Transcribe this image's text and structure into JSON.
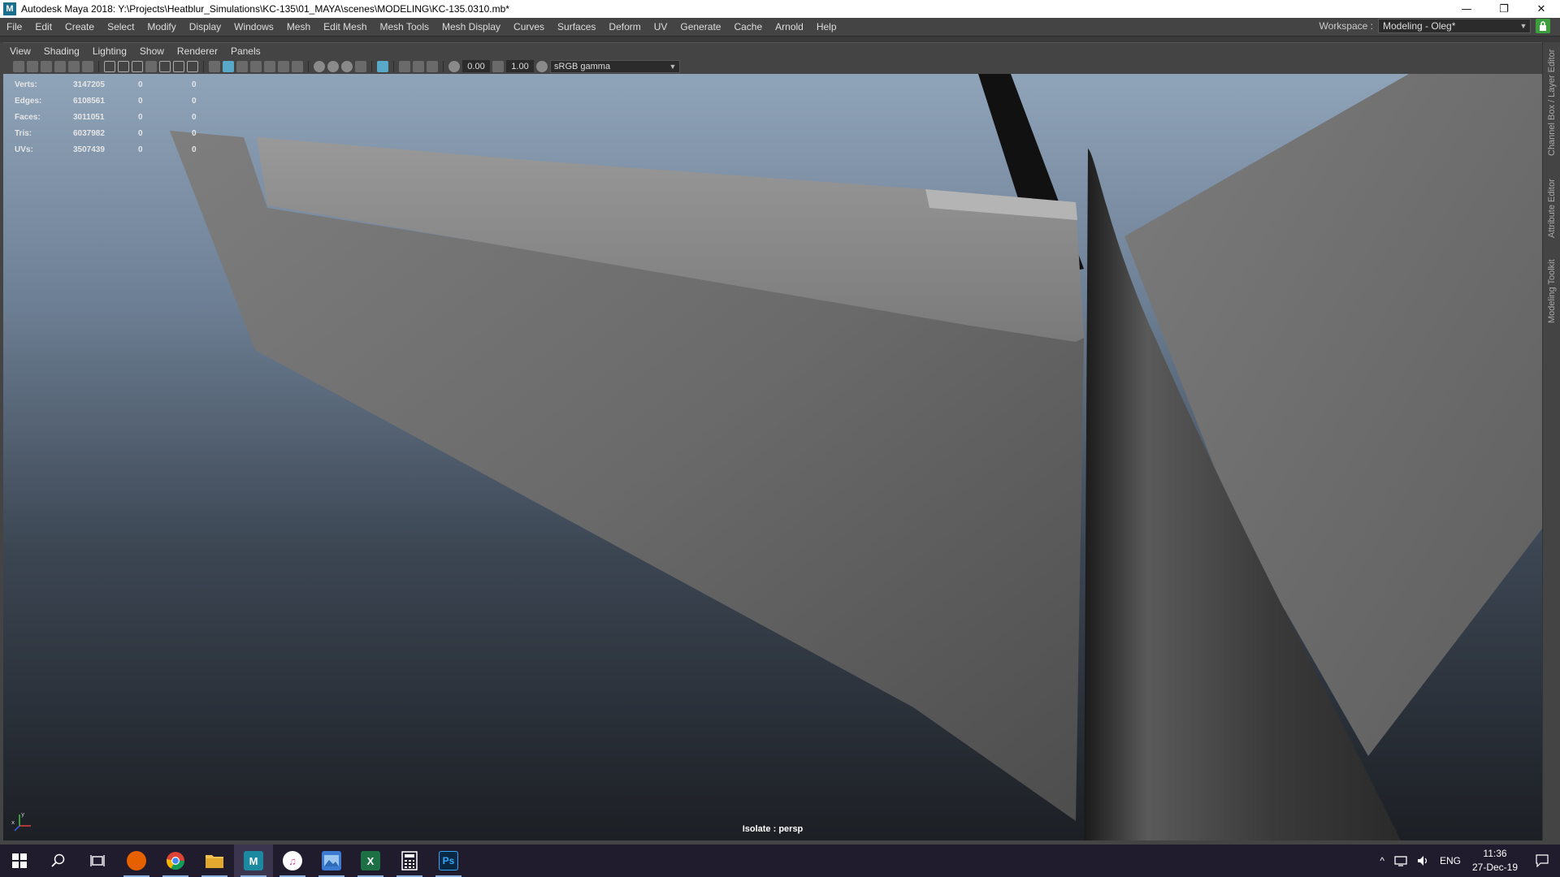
{
  "window": {
    "title": "Autodesk Maya 2018: Y:\\Projects\\Heatblur_Simulations\\KC-135\\01_MAYA\\scenes\\MODELING\\KC-135.0310.mb*",
    "app_icon_letter": "M",
    "minimize": "—",
    "restore": "❐",
    "close": "✕"
  },
  "menubar": {
    "items": [
      "File",
      "Edit",
      "Create",
      "Select",
      "Modify",
      "Display",
      "Windows",
      "Mesh",
      "Edit Mesh",
      "Mesh Tools",
      "Mesh Display",
      "Curves",
      "Surfaces",
      "Deform",
      "UV",
      "Generate",
      "Cache",
      "Arnold",
      "Help"
    ],
    "workspace_label": "Workspace :",
    "workspace_value": "Modeling - Oleg*"
  },
  "panel_menu": {
    "items": [
      "View",
      "Shading",
      "Lighting",
      "Show",
      "Renderer",
      "Panels"
    ]
  },
  "viewport_toolbar": {
    "exposure": "0.00",
    "gamma": "1.00",
    "color_space": "sRGB gamma"
  },
  "hud": {
    "rows": [
      {
        "label": "Verts:",
        "value": "3147205",
        "c1": "0",
        "c2": "0"
      },
      {
        "label": "Edges:",
        "value": "6108561",
        "c1": "0",
        "c2": "0"
      },
      {
        "label": "Faces:",
        "value": "3011051",
        "c1": "0",
        "c2": "0"
      },
      {
        "label": "Tris:",
        "value": "6037982",
        "c1": "0",
        "c2": "0"
      },
      {
        "label": "UVs:",
        "value": "3507439",
        "c1": "0",
        "c2": "0"
      }
    ]
  },
  "viewport": {
    "camera_label": "Isolate : persp",
    "axis_y": "y",
    "axis_x": "x"
  },
  "side_tabs": [
    "Channel Box / Layer Editor",
    "Attribute Editor",
    "Modeling Toolkit"
  ],
  "taskbar": {
    "apps": [
      {
        "name": "start",
        "icon": "windows-icon"
      },
      {
        "name": "search",
        "icon": "search-icon"
      },
      {
        "name": "task-view",
        "icon": "task-view-icon"
      },
      {
        "name": "firefox",
        "icon": "firefox-icon",
        "color": "#e66000"
      },
      {
        "name": "chrome",
        "icon": "chrome-icon",
        "color": "#4285f4"
      },
      {
        "name": "file-explorer",
        "icon": "folder-icon",
        "color": "#f2c14e"
      },
      {
        "name": "maya",
        "icon": "maya-icon",
        "color": "#1b8aa0",
        "letter": "M"
      },
      {
        "name": "itunes",
        "icon": "music-icon",
        "color": "#d94e9c"
      },
      {
        "name": "photo-viewer",
        "icon": "image-icon",
        "color": "#3b7bd4"
      },
      {
        "name": "excel",
        "icon": "excel-icon",
        "color": "#1d7044",
        "letter": "X"
      },
      {
        "name": "calculator",
        "icon": "calculator-icon",
        "color": "#555555"
      },
      {
        "name": "photoshop",
        "icon": "photoshop-icon",
        "color": "#0b2842",
        "letter": "Ps"
      }
    ],
    "language": "ENG",
    "time": "11:36",
    "date": "27-Dec-19"
  },
  "colors": {
    "maya_panel": "#444444",
    "accent": "#5aa8c8",
    "lock_green": "#3d9e3d",
    "taskbar": "#201b2d"
  }
}
